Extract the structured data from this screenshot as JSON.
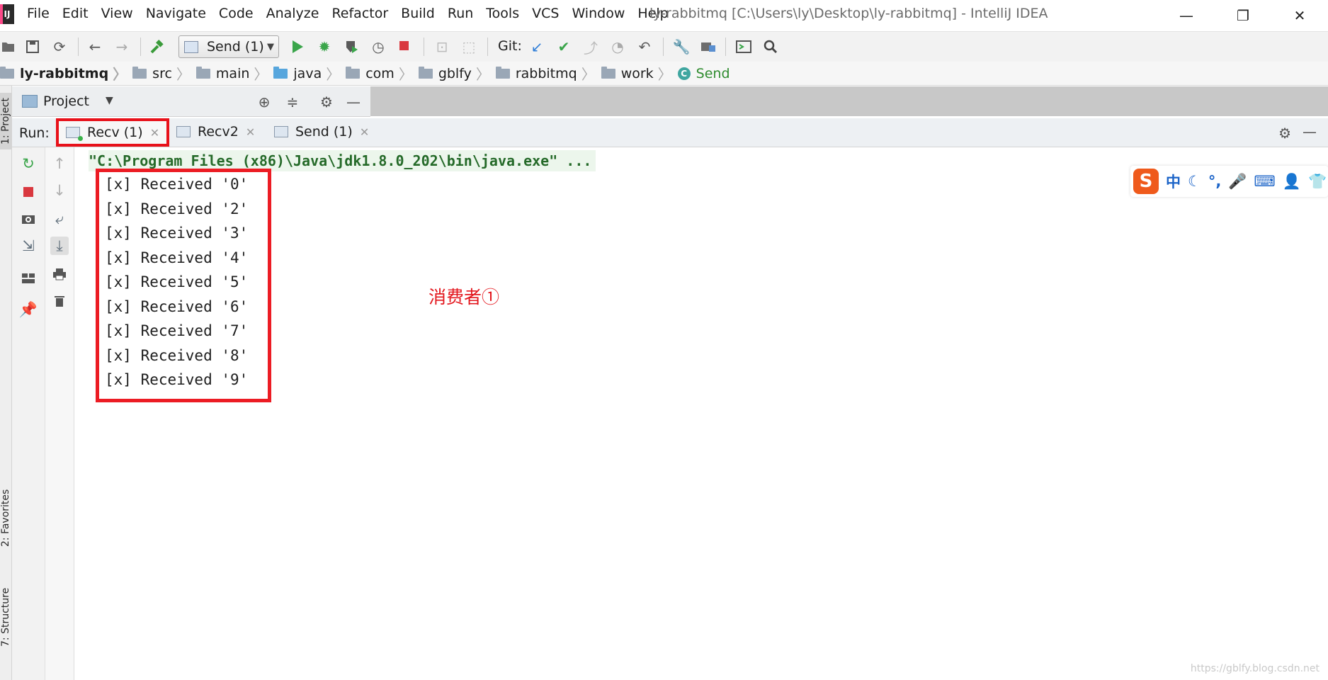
{
  "window": {
    "title": "ly-rabbitmq [C:\\Users\\ly\\Desktop\\ly-rabbitmq] - IntelliJ IDEA",
    "minimize": "—",
    "restore": "❐",
    "close": "✕"
  },
  "menu": [
    {
      "label": "File"
    },
    {
      "label": "Edit"
    },
    {
      "label": "View"
    },
    {
      "label": "Navigate"
    },
    {
      "label": "Code"
    },
    {
      "label": "Analyze"
    },
    {
      "label": "Refactor"
    },
    {
      "label": "Build"
    },
    {
      "label": "Run"
    },
    {
      "label": "Tools"
    },
    {
      "label": "VCS"
    },
    {
      "label": "Window"
    },
    {
      "label": "Help"
    }
  ],
  "toolbar": {
    "run_config": "Send (1)",
    "git_label": "Git:"
  },
  "breadcrumb": [
    {
      "label": "ly-rabbitmq"
    },
    {
      "label": "src"
    },
    {
      "label": "main"
    },
    {
      "label": "java"
    },
    {
      "label": "com"
    },
    {
      "label": "gblfy"
    },
    {
      "label": "rabbitmq"
    },
    {
      "label": "work"
    },
    {
      "label": "Send"
    }
  ],
  "left_stripe": {
    "project": "1: Project",
    "favorites": "2: Favorites",
    "structure": "7: Structure"
  },
  "project_panel": {
    "title": "Project"
  },
  "run": {
    "label": "Run:",
    "tabs": [
      {
        "label": "Recv (1)"
      },
      {
        "label": "Recv2"
      },
      {
        "label": "Send (1)"
      }
    ]
  },
  "console": {
    "command": "\"C:\\Program Files (x86)\\Java\\jdk1.8.0_202\\bin\\java.exe\" ...",
    "lines": [
      "[x] Received '0'",
      "[x] Received '2'",
      "[x] Received '3'",
      "[x] Received '4'",
      "[x] Received '5'",
      "[x] Received '6'",
      "[x] Received '7'",
      "[x] Received '8'",
      "[x] Received '9'"
    ],
    "annotation": "消费者①"
  },
  "ime": {
    "logo": "S",
    "mode": "中"
  },
  "watermark": "https://gblfy.blog.csdn.net",
  "colors": {
    "highlight_red": "#ec1c24",
    "command_green": "#256a29",
    "accent_blue": "#1c64c8"
  }
}
